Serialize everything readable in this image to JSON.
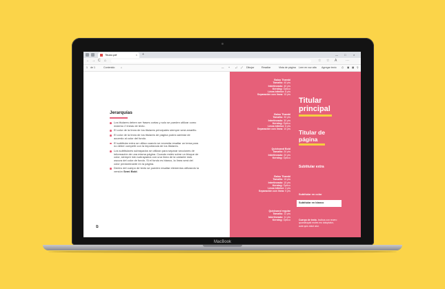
{
  "browser": {
    "tab_title": "Titular.pdf",
    "tab_close": "×",
    "new_tab": "+",
    "window": {
      "minimize": "—",
      "maximize": "□",
      "close": "×"
    },
    "nav": {
      "back": "←",
      "forward": "→",
      "refresh": "C",
      "home": "⌂"
    },
    "address_icons": {
      "favorite": "☆",
      "collections": "☆",
      "reading": "A",
      "more": "···"
    }
  },
  "pdf_toolbar": {
    "page_input": "1",
    "page_total": "de 1",
    "contents": "Contenido",
    "search": "⌕",
    "zoom_out": "—",
    "zoom_in": "+",
    "rotate": "⤾",
    "fit": "⤢",
    "draw": "Dibujar",
    "highlight": "Resaltar",
    "page_view": "Vista de página",
    "read_aloud": "Leer en voz alta",
    "add_text": "Agregar texto",
    "print": "⎙",
    "save": "▣",
    "save_as": "▦",
    "pin": "⚲"
  },
  "left_page": {
    "heading": "Jerarquías",
    "bullets": [
      {
        "text": "Los titulares deben ser frases cortas y solo se pueden utilizar como máximo 2 líneas de texto."
      },
      {
        "text": "El color de la línea de los titulares principales siempre será amarillo."
      },
      {
        "text": "El color de la línea de los titulares de página podrá cambiar de acuerdo al color del fondo."
      },
      {
        "text": "El subtitular extra se utiliza cuando se necesita resaltar un tema para no deber competir con la importancia de los titulares."
      },
      {
        "text": "Los subtitulares subrayados se utilizan para separar secciones de información de una misma página. Cuando estén sobre un bloque de color, siempre irán subrayados con una línea de la variante más oscura del color de fondo. Si el fondo es blanco, la línea será del color predominante en la página."
      },
      {
        "text_before": "Dentro del cuerpo de texto se pueden resaltar elementos utilizando la versión ",
        "text_bold": "Semi Bold",
        "text_after": "."
      }
    ],
    "page_icon": "⧉"
  },
  "right_page": {
    "specs": [
      {
        "title": "Baloo Thambi",
        "lines": [
          {
            "label": "Tamaño:",
            "value": "40 pts"
          },
          {
            "label": "Interlineado:",
            "value": "40 pts"
          },
          {
            "label": "Kerning:",
            "value": "Óptico"
          },
          {
            "label": "Línea inferior:",
            "value": "8 pts"
          },
          {
            "label": "Separación con línea:",
            "value": "15 pts"
          }
        ]
      },
      {
        "title": "Baloo Thambi",
        "lines": [
          {
            "label": "Tamaño:",
            "value": "30 pts"
          },
          {
            "label": "Interlineado:",
            "value": "30 pts"
          },
          {
            "label": "Kerning:",
            "value": "Óptico"
          },
          {
            "label": "Línea inferior:",
            "value": "6 pts"
          },
          {
            "label": "Separación con línea:",
            "value": "10 pts"
          }
        ]
      },
      {
        "title": "Quicksand Bold",
        "lines": [
          {
            "label": "Tamaño:",
            "value": "20 pts"
          },
          {
            "label": "Interlineado:",
            "value": "20 pts"
          },
          {
            "label": "Kerning:",
            "value": "Óptico"
          }
        ]
      },
      {
        "title": "Baloo Thambi",
        "lines": [
          {
            "label": "Tamaño:",
            "value": "15 pts"
          },
          {
            "label": "Interlineado:",
            "value": "15 pts"
          },
          {
            "label": "Kerning:",
            "value": "Óptico"
          },
          {
            "label": "Línea inferior:",
            "value": "4 pts"
          },
          {
            "label": "Separación con línea:",
            "value": "5 pts"
          }
        ]
      },
      {
        "title": "Quicksand regular",
        "lines": [
          {
            "label": "Tamaño:",
            "value": "12 pts"
          },
          {
            "label": "Interlineado:",
            "value": "11 pts"
          },
          {
            "label": "Kerning:",
            "value": "Óptico"
          }
        ]
      }
    ],
    "samples": {
      "titular_principal": "Titular principal",
      "titular_pagina": "Titular de página",
      "subtitular_extra": "Subtitular extra",
      "subtitular_color": "Subtitular en color",
      "subtitular_blanco": "Subtitular en blanco",
      "cuerpo_bold": "Cuerpo de texto.",
      "cuerpo_rest": " Incibus con recero quundisquid moles mo doluptatur, aute quis dolut atur."
    }
  },
  "laptop": {
    "brand": "MacBook"
  },
  "colors": {
    "background": "#fbd449",
    "accent_pink": "#e66079",
    "accent_yellow": "#f6cf3f"
  }
}
